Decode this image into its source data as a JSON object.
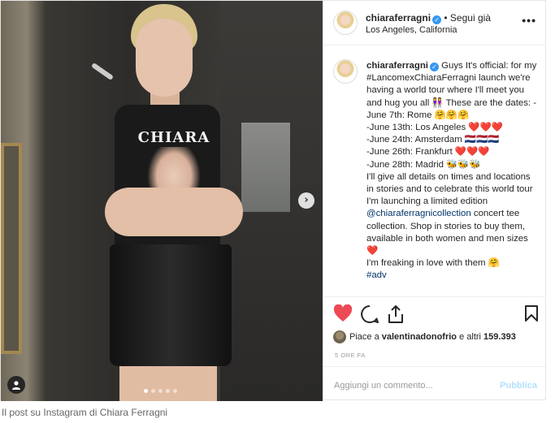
{
  "post": {
    "username": "chiaraferragni",
    "follow_status": "• Segui già",
    "location": "Los Angeles, California",
    "more_icon": "more-dots-icon",
    "shirt_print": "CHIARA",
    "caption_text": " Guys It's official: for my #LancomexChiaraFerragni launch we're having a world tour where I'll meet you and hug you all 👭 These are the dates: -June 7th: Rome 🤗🤗🤗\n-June 13th: Los Angeles ❤️❤️❤️\n-June 24th: Amsterdam 🇳🇱🇳🇱🇳🇱\n-June 26th: Frankfurt ❤️❤️❤️\n-June 28th: Madrid 🐝🐝🐝\nI'll give all details on times and locations in stories and to celebrate this world tour I'm launching a limited edition ",
    "caption_mention": "@chiaraferragnicollection",
    "caption_text2": " concert tee collection. Shop in stories to buy them, available in both women and men sizes ❤️\nI'm freaking in love with them 🤗\n",
    "caption_hashtag": "#adv",
    "likes_prefix": "Piace a ",
    "likes_user": "valentinadonofrio",
    "likes_middle": " e altri ",
    "likes_count": "159.393",
    "time_ago": "5 ORE FA",
    "comment_placeholder": "Aggiungi un commento...",
    "publish_label": "Pubblica",
    "carousel_total": 5,
    "carousel_active": 1
  },
  "figure_caption": "Il post su Instagram di Chiara Ferragni",
  "colors": {
    "like_red": "#ed4956",
    "verified_blue": "#3897f0",
    "publish_disabled": "#b2dffc"
  }
}
